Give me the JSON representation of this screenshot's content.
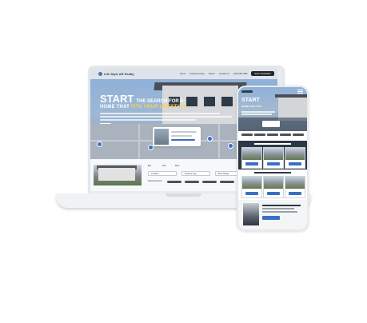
{
  "brand": {
    "name": "Life Style AR Realty",
    "accent": "#3b6fc4",
    "highlight": "#ffd24d"
  },
  "laptop": {
    "nav": {
      "items": [
        "Home",
        "Featured Listing",
        "Search",
        "Contact Us",
        "(123) 456-7890"
      ],
      "cta": "Start Consultation"
    },
    "hero": {
      "line1_big": "START",
      "line1_small": "THE SEARCH FOR A",
      "line2_prefix": "HOME THAT",
      "line2_highlight": "FITS YOUR LIFESTYLE"
    },
    "search": {
      "tabs": [
        "Buy",
        "Sell",
        "Rent"
      ],
      "location_placeholder": "Location",
      "property_type_placeholder": "Property Type",
      "price_range_placeholder": "Price Range",
      "popular_label": "Popular Search:"
    }
  },
  "phone": {
    "hero": {
      "line1": "START",
      "line2": "HOME THAT FITS"
    }
  }
}
